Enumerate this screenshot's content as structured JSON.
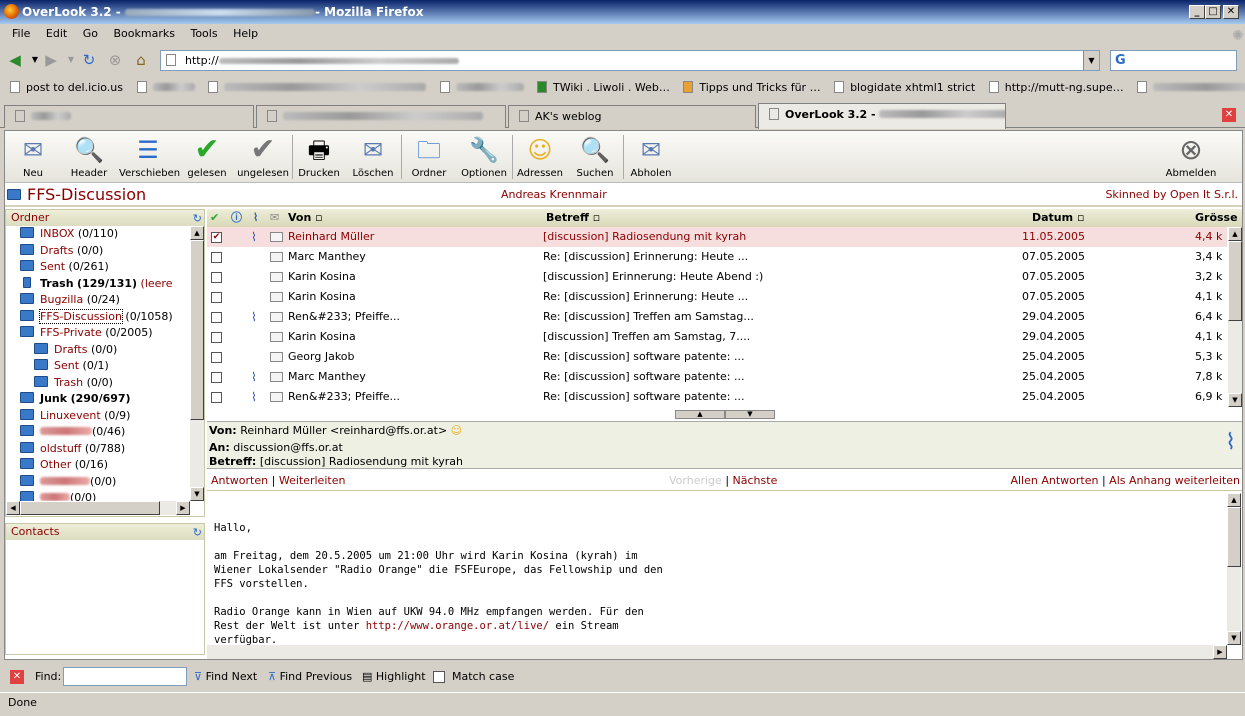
{
  "window": {
    "title": "OverLook 3.2 - ",
    "title_suffix": "- Mozilla Firefox"
  },
  "menu": [
    "File",
    "Edit",
    "Go",
    "Bookmarks",
    "Tools",
    "Help"
  ],
  "url": "http://",
  "bookmarks": [
    "post to del.icio.us",
    "",
    "",
    "",
    "TWiki . Liwoli . Web…",
    "Tipps und Tricks für …",
    "blogidate xhtml1 strict",
    "http://mutt-ng.supe…",
    ""
  ],
  "tabs": [
    "",
    "",
    "AK's weblog",
    "OverLook 3.2 - "
  ],
  "toolbar": {
    "neu": "Neu",
    "header": "Header",
    "verschieben": "Verschieben",
    "gelesen": "gelesen",
    "ungelesen": "ungelesen",
    "drucken": "Drucken",
    "loeschen": "Löschen",
    "ordner": "Ordner",
    "optionen": "Optionen",
    "adressen": "Adressen",
    "suchen": "Suchen",
    "abholen": "Abholen",
    "abmelden": "Abmelden"
  },
  "header": {
    "folder_title": "FFS-Discussion",
    "user": "Andreas Krennmair",
    "skin": "Skinned by Open It S.r.l."
  },
  "ordner": {
    "label": "Ordner",
    "folders": [
      {
        "name": "INBOX",
        "count": "(0/110)"
      },
      {
        "name": "Drafts",
        "count": "(0/0)"
      },
      {
        "name": "Sent",
        "count": "(0/261)"
      },
      {
        "name": "Trash",
        "count": "(129/131)",
        "extra": "(leere"
      },
      {
        "name": "Bugzilla",
        "count": "(0/24)"
      },
      {
        "name": "FFS-Discussion",
        "count": "(0/1058)"
      },
      {
        "name": "FFS-Private",
        "count": "(0/2005)"
      },
      {
        "name": "Drafts",
        "count": "(0/0)"
      },
      {
        "name": "Sent",
        "count": "(0/1)"
      },
      {
        "name": "Trash",
        "count": "(0/0)"
      },
      {
        "name": "Junk",
        "count": "(290/697)"
      },
      {
        "name": "Linuxevent",
        "count": "(0/9)"
      },
      {
        "name": "",
        "count": "(0/46)"
      },
      {
        "name": "oldstuff",
        "count": "(0/788)"
      },
      {
        "name": "Other",
        "count": "(0/16)"
      },
      {
        "name": "",
        "count": "(0/0)"
      },
      {
        "name": "",
        "count": "(0/0)"
      }
    ]
  },
  "contacts": {
    "label": "Contacts"
  },
  "list": {
    "columns": {
      "from": "Von",
      "subject": "Betreff",
      "date": "Datum",
      "size": "Grösse"
    },
    "rows": [
      {
        "from": "Reinhard Müller",
        "subject": "[discussion] Radiosendung mit kyrah",
        "date": "11.05.2005",
        "size": "4,4 k"
      },
      {
        "from": "Marc Manthey",
        "subject": "Re: [discussion] Erinnerung: Heute ...",
        "date": "07.05.2005",
        "size": "3,4 k"
      },
      {
        "from": "Karin Kosina",
        "subject": "[discussion] Erinnerung: Heute Abend :)",
        "date": "07.05.2005",
        "size": "3,2 k"
      },
      {
        "from": "Karin Kosina",
        "subject": "Re: [discussion] Erinnerung: Heute ...",
        "date": "07.05.2005",
        "size": "4,1 k"
      },
      {
        "from": "Ren&#233; Pfeiffe...",
        "subject": "Re: [discussion] Treffen am Samstag...",
        "date": "29.04.2005",
        "size": "6,4 k"
      },
      {
        "from": "Karin Kosina",
        "subject": "[discussion] Treffen am Samstag, 7....",
        "date": "29.04.2005",
        "size": "4,1 k"
      },
      {
        "from": "Georg Jakob",
        "subject": "Re: [discussion] software patente: ...",
        "date": "25.04.2005",
        "size": "5,3 k"
      },
      {
        "from": "Marc Manthey",
        "subject": "Re: [discussion] software patente: ...",
        "date": "25.04.2005",
        "size": "7,8 k"
      },
      {
        "from": "Ren&#233; Pfeiffe...",
        "subject": "Re: [discussion] software patente: ...",
        "date": "25.04.2005",
        "size": "6,9 k"
      }
    ]
  },
  "preview": {
    "von_label": "Von:",
    "von": "Reinhard Müller <reinhard@ffs.or.at>",
    "an_label": "An:",
    "an": "discussion@ffs.or.at",
    "betreff_label": "Betreff:",
    "betreff": "[discussion] Radiosendung mit kyrah"
  },
  "actions": {
    "reply": "Antworten",
    "forward": "Weiterleiten",
    "prev": "Vorherige",
    "next": "Nächste",
    "reply_all": "Allen Antworten",
    "forward_attach": "Als Anhang weiterleiten",
    "sep": "|"
  },
  "body": {
    "l1": "Hallo,",
    "l2": "am Freitag, dem 20.5.2005 um 21:00 Uhr wird Karin Kosina (kyrah) im",
    "l3": "Wiener Lokalsender \"Radio Orange\" die FSFEurope, das Fellowship und den",
    "l4": "FFS vorstellen.",
    "l5": "Radio Orange kann in Wien auf UKW 94.0 MHz empfangen werden. Für den",
    "l6a": "Rest der Welt ist unter ",
    "l6link": "http://www.orange.or.at/live/",
    "l6b": " ein Stream",
    "l7": "verfügbar."
  },
  "findbar": {
    "label": "Find:",
    "next": "Find Next",
    "previous": "Find Previous",
    "highlight": "Highlight",
    "matchcase": "Match case"
  },
  "status": "Done"
}
